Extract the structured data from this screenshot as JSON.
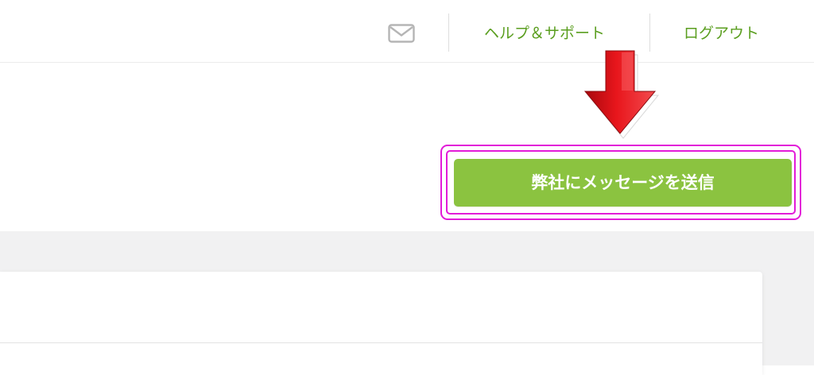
{
  "header": {
    "mail_icon": "envelope-icon",
    "help_label": "ヘルプ＆サポート",
    "logout_label": "ログアウト"
  },
  "annotation": {
    "arrow_icon": "arrow-down-icon"
  },
  "action": {
    "send_message_label": "弊社にメッセージを送信"
  },
  "colors": {
    "link_green": "#5a9e1f",
    "button_green": "#8bc340",
    "highlight_magenta": "#e21bd8",
    "arrow_red": "#e0141a",
    "icon_grey": "#b5b5b5",
    "background_grey": "#f1f1f2"
  }
}
